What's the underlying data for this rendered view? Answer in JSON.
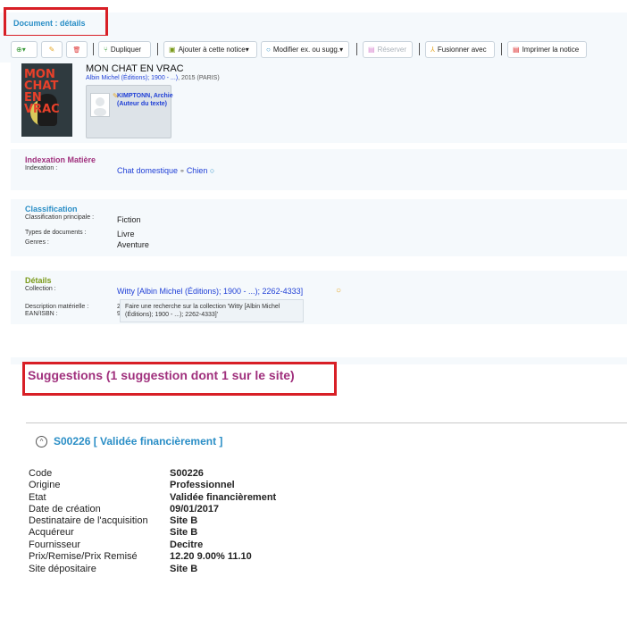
{
  "header": {
    "title": "Document : détails"
  },
  "toolbar": {
    "buttons": [
      {
        "label": ""
      },
      {
        "label": ""
      },
      {
        "label": ""
      },
      {
        "label": "Dupliquer"
      },
      {
        "label": "Ajouter à cette notice▾"
      },
      {
        "label": "Modifier ex. ou sugg.▾"
      },
      {
        "label": "Réserver"
      },
      {
        "label": "Fusionner avec"
      },
      {
        "label": "Imprimer la notice"
      }
    ],
    "icons": {
      "add": "⊕▾",
      "edit": "✎",
      "delete": "🗑",
      "duplicate": "⑂",
      "append": "▣",
      "search": "○",
      "reserve": "▤",
      "merge": "⅄",
      "print": "▤"
    }
  },
  "notice": {
    "cover_text": "MON CHAT EN VRAC",
    "title": "MON CHAT EN VRAC",
    "publisher_link": "Albin Michel (Éditions); 1900 - ...)",
    "publisher_rest": ", 2015 (PARIS)",
    "author_name": "KIMPTONN, Archie",
    "author_role": "(Auteur du texte)"
  },
  "indexation": {
    "title": "Indexation Matière",
    "label": "Indexation :",
    "value": "Chat domestique",
    "sep": " ⚭ ",
    "value2": "Chien"
  },
  "classification": {
    "title": "Classification",
    "principale_label": "Classification principale :",
    "principale_value": "Fiction",
    "types_label": "Types de documents :",
    "types_value": "Livre",
    "genres_label": "Genres :",
    "genres_value": "Aventure"
  },
  "details": {
    "title": "Détails",
    "collection_label": "Collection :",
    "collection_value": "Witty [Albin Michel (Éditions); 1900 - ...); 2262-4333]",
    "desc_label": "Description matérielle :",
    "ean_label": "EAN/ISBN :",
    "desc_value_partial": "2",
    "ean_value_partial": "9",
    "tooltip": "Faire une recherche sur la collection 'Witty [Albin Michel (Éditions); 1900 - ...); 2262-4333]'"
  },
  "suggestions": {
    "title": "Suggestions (1 suggestion dont 1 sur le site)",
    "heading": "S00226 [ Validée financièrement ]",
    "rows": [
      {
        "label": "Code",
        "value": "S00226"
      },
      {
        "label": "Origine",
        "value": "Professionnel"
      },
      {
        "label": "Etat",
        "value": "Validée financièrement"
      },
      {
        "label": "Date de création",
        "value": "09/01/2017"
      },
      {
        "label": "Destinataire de l'acquisition",
        "value": "Site B"
      },
      {
        "label": "Acquéreur",
        "value": "Site B"
      },
      {
        "label": "Fournisseur",
        "value": "Decitre"
      },
      {
        "label": "Prix/Remise/Prix Remisé",
        "value": "12.20 9.00% 11.10"
      },
      {
        "label": "Site dépositaire",
        "value": "Site B"
      }
    ]
  },
  "colors": {
    "accent": "#2a8ec6",
    "link": "#1f3fd6",
    "indexation": "#a0307d",
    "classification": "#2a8ec6",
    "details": "#7a9a1a",
    "highlight_box": "#d81f26"
  }
}
